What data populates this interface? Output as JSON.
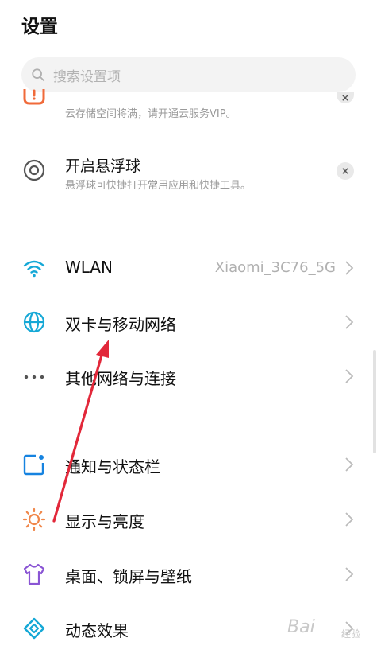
{
  "header": {
    "title": "设置"
  },
  "search": {
    "placeholder": "搜索设置项"
  },
  "cards": [
    {
      "title": "",
      "description": "云存储空间将满，请开通云服务VIP。",
      "icon": "cloud-warning-icon"
    },
    {
      "title": "开启悬浮球",
      "description": "悬浮球可快捷打开常用应用和快捷工具。",
      "icon": "floating-ball-icon"
    }
  ],
  "network": {
    "wlan": {
      "label": "WLAN",
      "value": "Xiaomi_3C76_5G",
      "icon": "wifi-icon"
    },
    "sim": {
      "label": "双卡与移动网络",
      "icon": "globe-icon"
    },
    "other": {
      "label": "其他网络与连接",
      "icon": "more-dots-icon"
    }
  },
  "display": {
    "notifications": {
      "label": "通知与状态栏",
      "icon": "notification-icon"
    },
    "brightness": {
      "label": "显示与亮度",
      "icon": "sun-icon"
    },
    "wallpaper": {
      "label": "桌面、锁屏与壁纸",
      "icon": "shirt-icon"
    },
    "effects": {
      "label": "动态效果",
      "icon": "diamond-icon"
    }
  },
  "watermark": {
    "text": "Bai",
    "sub": "经验"
  },
  "colors": {
    "accent": "#15a8d6",
    "warning": "#f06a3a",
    "annotation": "#e2283a",
    "sun": "#f0874a",
    "purple": "#8a55d4",
    "blue": "#1683e0"
  }
}
